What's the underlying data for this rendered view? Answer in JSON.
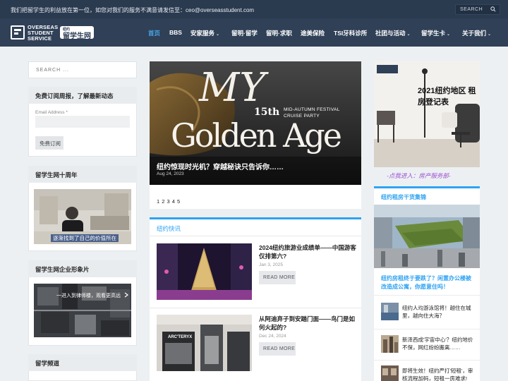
{
  "topbar": {
    "message": "我们把留学生的利益放在第一位，如您对我们的服务不满意请发信至：ceo@overseasstudent.com",
    "search_placeholder": "SEARCH"
  },
  "brand": {
    "logo_text_1": "OVERSEAS",
    "logo_text_2": "STUDENT",
    "logo_text_3": "SERVICE",
    "badge_small": "纽约",
    "badge_main": "留学生网"
  },
  "nav": {
    "items": [
      "首页",
      "BBS",
      "安家服务",
      "留明·留学",
      "留明·求职",
      "途美保险",
      "TSI牙科诊所",
      "社团与活动",
      "留学生卡",
      "关于我们"
    ]
  },
  "sidebar": {
    "search_placeholder": "SEARCH ...",
    "subscribe_title": "免费订阅周报，了解最新动态",
    "email_label": "Email Address *",
    "subscribe_button": "免费订阅",
    "anniversary_title": "留学生网十周年",
    "anniversary_caption": "逐渐找到了自己的价值所在",
    "corporate_title": "留学生网企业形象片",
    "corporate_caption": "一进入到律师楼，观看更高远",
    "channel_title": "留学频道"
  },
  "hero": {
    "art_line_1": "MY",
    "art_number": "15th",
    "art_event_1": "MID-AUTUMN FESTIVAL",
    "art_event_2": "CRUISE PARTY",
    "art_line_2": "Golden Age",
    "title": "纽约惊现时光机？穿越秘诀只告诉你……",
    "date": "Aug 24, 2023",
    "pager": "1 2 3 4 5"
  },
  "news": {
    "heading": "纽约快讯",
    "items": [
      {
        "title": "2024纽约旅游业成绩单——中国游客仅排第六?",
        "date": "Jan 3, 2025",
        "more": "READ MORE"
      },
      {
        "title": "从阿迪弃子到安踏门面——鸟门是如何火起的?",
        "date": "Dec 24, 2024",
        "more": "READ MORE",
        "store_sign": "ARC'TERYX"
      }
    ]
  },
  "right": {
    "ad_title": "2021纽约地区 租房登记表",
    "ad_link": "-点我进入：房产服务部-",
    "panel_heading": "纽约租房干货集锦",
    "big_title": "纽约房租终于要跌了？闲置办公楼被改造成公寓，你愿意住吗！",
    "items": [
      "纽约人均游泳馆将！越住在城里，越向住大海？",
      "新泽西成'宇宙中心'？纽约地价不保，网红纷纷搬离……",
      "即将生效！纽约严打'短租'，审核流程加码，短租一房难求!"
    ]
  },
  "colors": {
    "accent": "#2ea3f2",
    "topbar": "#2a3a4f",
    "header": "#2f4057",
    "ad_link": "#9b4fd0"
  }
}
